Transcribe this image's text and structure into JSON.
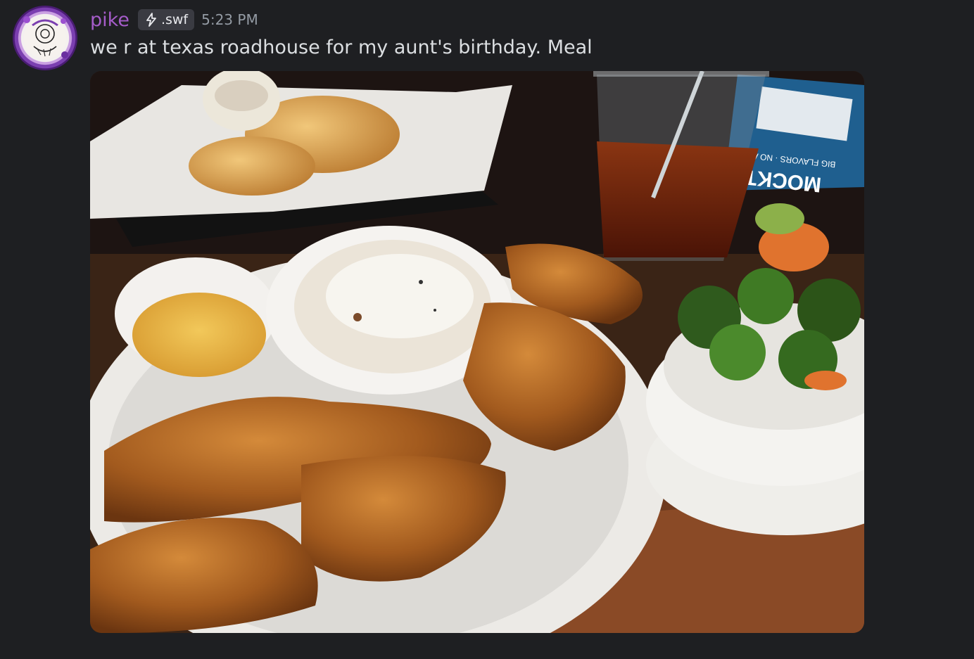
{
  "message": {
    "author": {
      "username": "pike",
      "tag_text": ".swf",
      "tag_icon": "lightning-bolt-icon"
    },
    "timestamp": "5:23 PM",
    "text": "we r at texas roadhouse for my aunt's birthday. Meal",
    "attachment": {
      "type": "image",
      "visible_text": [
        "MOCKTA",
        "BIG FLAVORS · NO AL"
      ]
    }
  },
  "colors": {
    "background": "#1e1f22",
    "username": "#a55cc9",
    "timestamp": "#949ba4",
    "message_text": "#dbdee1",
    "tag_background": "#3a3b42"
  }
}
